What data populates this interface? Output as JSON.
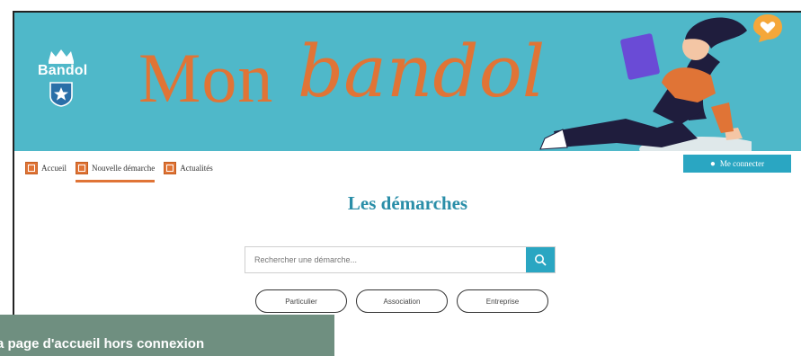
{
  "banner": {
    "logo_text": "Bandol",
    "title_serif": "Mon",
    "title_script": "bandol"
  },
  "nav": {
    "items": [
      {
        "label": "Accueil",
        "icon": "home-icon",
        "active": false
      },
      {
        "label": "Nouvelle démarche",
        "icon": "add-document-icon",
        "active": true
      },
      {
        "label": "Actualités",
        "icon": "news-icon",
        "active": false
      }
    ],
    "login_label": "Me connecter"
  },
  "main": {
    "title": "Les démarches",
    "search_placeholder": "Rechercher une démarche...",
    "filters": [
      "Particulier",
      "Association",
      "Entreprise"
    ]
  },
  "caption": {
    "text": "a page d'accueil hors connexion"
  },
  "colors": {
    "banner": "#4fb8c9",
    "accent": "#e07436",
    "primary": "#2aa6c2",
    "caption_bg": "#6f8f80"
  }
}
